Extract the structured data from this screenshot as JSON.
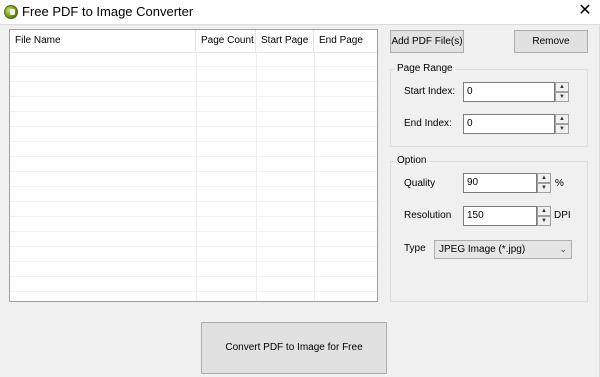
{
  "window": {
    "title": "Free PDF to Image Converter",
    "close_glyph": "✕"
  },
  "file_list": {
    "columns": [
      "File Name",
      "Page Count",
      "Start Page",
      "End Page"
    ],
    "rows": []
  },
  "toolbar": {
    "add_label": "Add PDF File(s)",
    "remove_label": "Remove"
  },
  "page_range": {
    "title": "Page Range",
    "start_label": "Start Index:",
    "start_value": "0",
    "end_label": "End Index:",
    "end_value": "0"
  },
  "option": {
    "title": "Option",
    "quality_label": "Quality",
    "quality_value": "90",
    "quality_unit": "%",
    "resolution_label": "Resolution",
    "resolution_value": "150",
    "resolution_unit": "DPI",
    "type_label": "Type",
    "type_value": "JPEG Image (*.jpg)"
  },
  "convert_label": "Convert PDF to Image for Free",
  "spin_up_glyph": "▲",
  "spin_down_glyph": "▼",
  "combo_arrow_glyph": "⌄",
  "icons": [
    "app-icon",
    "close-icon",
    "spin-up-icon",
    "spin-down-icon",
    "chevron-down-icon"
  ]
}
